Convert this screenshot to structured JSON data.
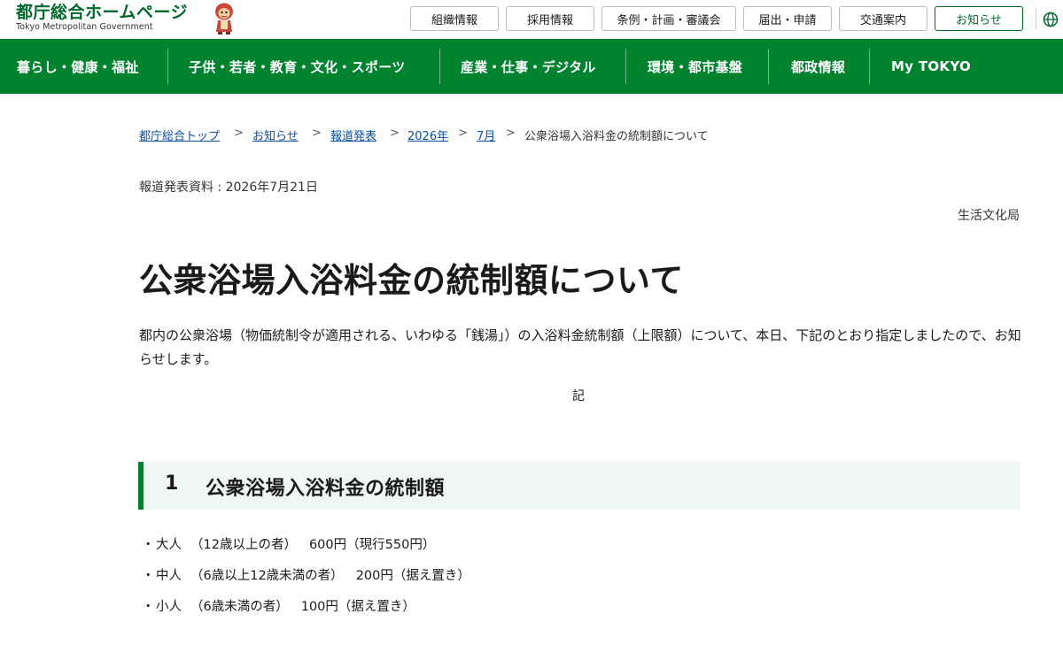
{
  "header": {
    "logo_title": "都庁総合ホームページ",
    "logo_subtitle": "Tokyo Metropolitan Government",
    "top_links": [
      {
        "label": "組織情報"
      },
      {
        "label": "採用情報"
      },
      {
        "label": "条例・計画・審議会"
      },
      {
        "label": "届出・申請"
      },
      {
        "label": "交通案内"
      },
      {
        "label": "お知らせ",
        "active": true
      }
    ]
  },
  "main_nav": [
    {
      "label": "暮らし・健康・福祉"
    },
    {
      "label": "子供・若者・教育・文化・スポーツ"
    },
    {
      "label": "産業・仕事・デジタル"
    },
    {
      "label": "環境・都市基盤"
    },
    {
      "label": "都政情報"
    },
    {
      "label": "My TOKYO"
    }
  ],
  "breadcrumb": {
    "links": [
      {
        "label": "都庁総合トップ"
      },
      {
        "label": "お知らせ"
      },
      {
        "label": "報道発表"
      },
      {
        "label": "2026年"
      },
      {
        "label": "7月"
      }
    ],
    "separator": ">",
    "current": "公衆浴場入浴料金の統制額について"
  },
  "article": {
    "release_date": "報道発表資料 : 2026年7月21日",
    "bureau": "生活文化局",
    "title": "公衆浴場入浴料金の統制額について",
    "intro": "都内の公衆浴場（物価統制令が適用される、いわゆる「銭湯」）の入浴料金統制額（上限額）について、本日、下記のとおり指定しましたので、お知らせします。",
    "ki": "記",
    "section": {
      "number": "1",
      "title": "公衆浴場入浴料金の統制額"
    },
    "fees": [
      {
        "bullet": "・",
        "category": "大人",
        "condition": "（12歳以上の者）",
        "price": "600円",
        "note": "（現行550円）"
      },
      {
        "bullet": "・",
        "category": "中人",
        "condition": "（6歳以上12歳未満の者）",
        "price": "200円",
        "note": "（据え置き）"
      },
      {
        "bullet": "・",
        "category": "小人",
        "condition": "（6歳未満の者）",
        "price": "100円",
        "note": "（据え置き）"
      }
    ]
  },
  "colors": {
    "brand_green": "#00822f",
    "logo_green": "#00692b",
    "link_blue": "#0b4fa0",
    "section_bg": "#eef7f1"
  },
  "icons": {
    "mascot": "mascot-icon",
    "globe": "globe-icon",
    "breadcrumb_separator": "chevron-right-icon"
  }
}
